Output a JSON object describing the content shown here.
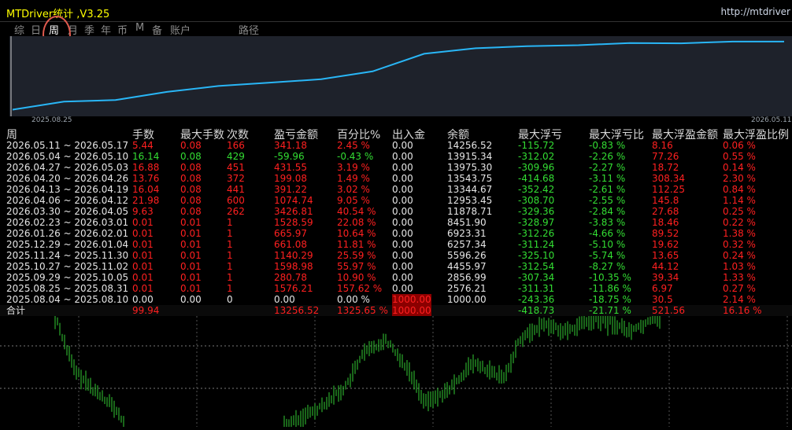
{
  "app": {
    "title": "MTDriver统计 ,V3.25",
    "url": "http://mtdriver"
  },
  "tabs": [
    {
      "label": "综"
    },
    {
      "label": "日"
    },
    {
      "label": "周",
      "active": true
    },
    {
      "label": "月"
    },
    {
      "label": "季"
    },
    {
      "label": "年"
    },
    {
      "label": "币"
    },
    {
      "label": "M"
    },
    {
      "label": "备"
    },
    {
      "label": "账户"
    },
    {
      "label": "路径"
    }
  ],
  "equity": {
    "start_date": "2025.08.25",
    "end_date": "2026.05.11",
    "values": [
      1000.0,
      2576.21,
      2856.99,
      4455.97,
      5596.26,
      6257.34,
      6923.31,
      8451.9,
      11878.71,
      12953.45,
      13344.67,
      13543.75,
      13975.3,
      13915.34,
      14256.52,
      14256.52
    ],
    "line_color": "#29b6f6"
  },
  "table": {
    "headers": [
      "周",
      "手数",
      "最大手数",
      "次数",
      "盈亏金额",
      "百分比%",
      "出入金",
      "余额",
      "最大浮亏",
      "最大浮亏比",
      "最大浮盈金额",
      "最大浮盈比例"
    ],
    "rows": [
      {
        "period": "2026.05.11 ~ 2026.05.17",
        "lots": "5.44",
        "max_lots": "0.08",
        "count": "166",
        "pnl": "341.18",
        "pct": "2.45 %",
        "inout": "0.00",
        "balance": "14256.52",
        "max_float_loss": "-115.72",
        "max_float_loss_pct": "-0.83 %",
        "max_float_gain": "8.16",
        "max_float_gain_pct": "0.06 %",
        "pos": true
      },
      {
        "period": "2026.05.04 ~ 2026.05.10",
        "lots": "16.14",
        "max_lots": "0.08",
        "count": "429",
        "pnl": "-59.96",
        "pct": "-0.43 %",
        "inout": "0.00",
        "balance": "13915.34",
        "max_float_loss": "-312.02",
        "max_float_loss_pct": "-2.26 %",
        "max_float_gain": "77.26",
        "max_float_gain_pct": "0.55 %",
        "pos": false
      },
      {
        "period": "2026.04.27 ~ 2026.05.03",
        "lots": "16.88",
        "max_lots": "0.08",
        "count": "451",
        "pnl": "431.55",
        "pct": "3.19 %",
        "inout": "0.00",
        "balance": "13975.30",
        "max_float_loss": "-309.96",
        "max_float_loss_pct": "-2.27 %",
        "max_float_gain": "18.72",
        "max_float_gain_pct": "0.14 %",
        "pos": true
      },
      {
        "period": "2026.04.20 ~ 2026.04.26",
        "lots": "13.76",
        "max_lots": "0.08",
        "count": "372",
        "pnl": "199.08",
        "pct": "1.49 %",
        "inout": "0.00",
        "balance": "13543.75",
        "max_float_loss": "-414.68",
        "max_float_loss_pct": "-3.11 %",
        "max_float_gain": "308.34",
        "max_float_gain_pct": "2.30 %",
        "pos": true
      },
      {
        "period": "2026.04.13 ~ 2026.04.19",
        "lots": "16.04",
        "max_lots": "0.08",
        "count": "441",
        "pnl": "391.22",
        "pct": "3.02 %",
        "inout": "0.00",
        "balance": "13344.67",
        "max_float_loss": "-352.42",
        "max_float_loss_pct": "-2.61 %",
        "max_float_gain": "112.25",
        "max_float_gain_pct": "0.84 %",
        "pos": true
      },
      {
        "period": "2026.04.06 ~ 2026.04.12",
        "lots": "21.98",
        "max_lots": "0.08",
        "count": "600",
        "pnl": "1074.74",
        "pct": "9.05 %",
        "inout": "0.00",
        "balance": "12953.45",
        "max_float_loss": "-308.70",
        "max_float_loss_pct": "-2.55 %",
        "max_float_gain": "145.8",
        "max_float_gain_pct": "1.14 %",
        "pos": true
      },
      {
        "period": "2026.03.30 ~ 2026.04.05",
        "lots": "9.63",
        "max_lots": "0.08",
        "count": "262",
        "pnl": "3426.81",
        "pct": "40.54 %",
        "inout": "0.00",
        "balance": "11878.71",
        "max_float_loss": "-329.36",
        "max_float_loss_pct": "-2.84 %",
        "max_float_gain": "27.68",
        "max_float_gain_pct": "0.25 %",
        "pos": true
      },
      {
        "period": "2026.02.23 ~ 2026.03.01",
        "lots": "0.01",
        "max_lots": "0.01",
        "count": "1",
        "pnl": "1528.59",
        "pct": "22.08 %",
        "inout": "0.00",
        "balance": "8451.90",
        "max_float_loss": "-328.97",
        "max_float_loss_pct": "-3.83 %",
        "max_float_gain": "18.46",
        "max_float_gain_pct": "0.22 %",
        "pos": true
      },
      {
        "period": "2026.01.26 ~ 2026.02.01",
        "lots": "0.01",
        "max_lots": "0.01",
        "count": "1",
        "pnl": "665.97",
        "pct": "10.64 %",
        "inout": "0.00",
        "balance": "6923.31",
        "max_float_loss": "-312.26",
        "max_float_loss_pct": "-4.66 %",
        "max_float_gain": "89.52",
        "max_float_gain_pct": "1.38 %",
        "pos": true
      },
      {
        "period": "2025.12.29 ~ 2026.01.04",
        "lots": "0.01",
        "max_lots": "0.01",
        "count": "1",
        "pnl": "661.08",
        "pct": "11.81 %",
        "inout": "0.00",
        "balance": "6257.34",
        "max_float_loss": "-311.24",
        "max_float_loss_pct": "-5.10 %",
        "max_float_gain": "19.62",
        "max_float_gain_pct": "0.32 %",
        "pos": true
      },
      {
        "period": "2025.11.24 ~ 2025.11.30",
        "lots": "0.01",
        "max_lots": "0.01",
        "count": "1",
        "pnl": "1140.29",
        "pct": "25.59 %",
        "inout": "0.00",
        "balance": "5596.26",
        "max_float_loss": "-325.10",
        "max_float_loss_pct": "-5.74 %",
        "max_float_gain": "13.65",
        "max_float_gain_pct": "0.24 %",
        "pos": true
      },
      {
        "period": "2025.10.27 ~ 2025.11.02",
        "lots": "0.01",
        "max_lots": "0.01",
        "count": "1",
        "pnl": "1598.98",
        "pct": "55.97 %",
        "inout": "0.00",
        "balance": "4455.97",
        "max_float_loss": "-312.54",
        "max_float_loss_pct": "-8.27 %",
        "max_float_gain": "44.12",
        "max_float_gain_pct": "1.03 %",
        "pos": true
      },
      {
        "period": "2025.09.29 ~ 2025.10.05",
        "lots": "0.01",
        "max_lots": "0.01",
        "count": "1",
        "pnl": "280.78",
        "pct": "10.90 %",
        "inout": "0.00",
        "balance": "2856.99",
        "max_float_loss": "-307.34",
        "max_float_loss_pct": "-10.35 %",
        "max_float_gain": "39.34",
        "max_float_gain_pct": "1.33 %",
        "pos": true
      },
      {
        "period": "2025.08.25 ~ 2025.08.31",
        "lots": "0.01",
        "max_lots": "0.01",
        "count": "1",
        "pnl": "1576.21",
        "pct": "157.62 %",
        "inout": "0.00",
        "balance": "2576.21",
        "max_float_loss": "-311.31",
        "max_float_loss_pct": "-11.86 %",
        "max_float_gain": "6.97",
        "max_float_gain_pct": "0.27 %",
        "pos": true
      },
      {
        "period": "2025.08.04 ~ 2025.08.10",
        "lots": "0.00",
        "max_lots": "0.00",
        "count": "0",
        "pnl": "0.00",
        "pct": "0.00 %",
        "inout": "1000.00",
        "balance": "1000.00",
        "max_float_loss": "-243.36",
        "max_float_loss_pct": "-18.75 %",
        "max_float_gain": "30.5",
        "max_float_gain_pct": "2.14 %",
        "zero": true
      }
    ],
    "total": {
      "label": "合计",
      "lots": "99.94",
      "pnl": "13256.52",
      "pct": "1325.65 %",
      "inout": "1000.00",
      "max_float_loss": "-418.73",
      "max_float_loss_pct": "-21.71 %",
      "max_float_gain": "521.56",
      "max_float_gain_pct": "16.16 %"
    }
  },
  "colors": {
    "positive": "#ff2020",
    "negative": "#33dd33",
    "neutral": "#e6e6e6",
    "accent_title": "#ffff00",
    "candle": "#33cc33",
    "active_marker": "#e05a4e"
  }
}
